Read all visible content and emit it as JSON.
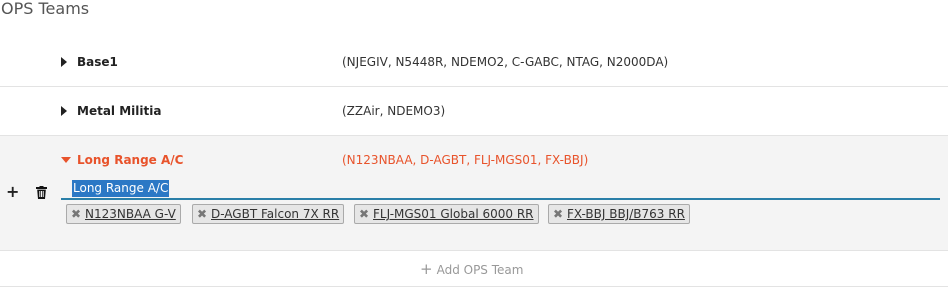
{
  "header": {
    "title": "OPS Teams"
  },
  "teams": [
    {
      "name": "Base1",
      "aircraft": "(NJEGIV, N5448R, NDEMO2, C-GABC, NTAG, N2000DA)"
    },
    {
      "name": "Metal Militia",
      "aircraft": "(ZZAir, NDEMO3)"
    },
    {
      "name": "Long Range A/C",
      "aircraft": "(N123NBAA, D-AGBT, FLJ-MGS01, FX-BBJ)",
      "expanded": true,
      "edit_name_value": "Long Range A/C",
      "chips": [
        {
          "label": "N123NBAA G-V"
        },
        {
          "label": "D-AGBT Falcon 7X RR"
        },
        {
          "label": "FLJ-MGS01 Global 6000 RR"
        },
        {
          "label": "FX-BBJ BBJ/B763 RR"
        }
      ]
    }
  ],
  "actions": {
    "add_team_label": "Add OPS Team",
    "add_icon_glyph": "+",
    "remove_chip_glyph": "✖"
  },
  "icons": {
    "row_add": "plus-icon",
    "row_delete": "trash-icon",
    "collapsed": "caret-right-icon",
    "expanded": "caret-down-icon"
  },
  "colors": {
    "accent": "#e8532b",
    "input_underline": "#2a7fa8",
    "selection": "#2b78c5"
  }
}
